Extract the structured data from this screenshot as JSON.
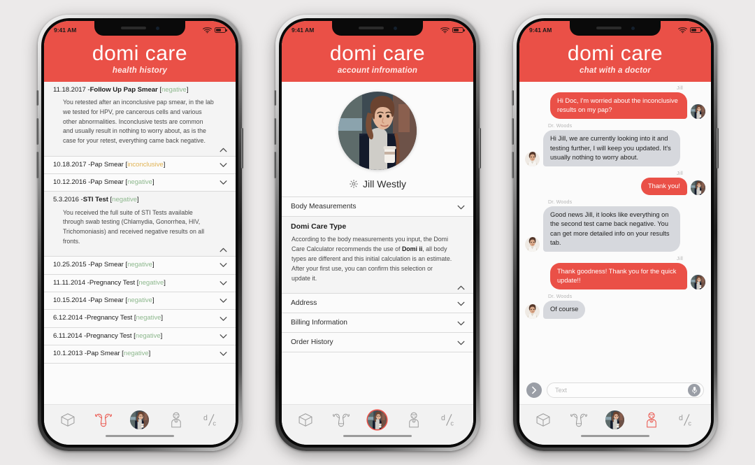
{
  "app": {
    "brand": "domi care",
    "accent": "#ea5047",
    "background": "#eceaea",
    "negative_color": "#8fb98f",
    "inconclusive_color": "#e0b354"
  },
  "status_bar": {
    "time": "9:41 AM",
    "wifi": "wifi-icon",
    "battery": "battery-icon"
  },
  "phone1": {
    "subtitle": "health history",
    "items": [
      {
        "date": "11.18.2017 - ",
        "title": "Follow Up Pap Smear",
        "bold": true,
        "result": "negative",
        "result_type": "negative",
        "open": true,
        "body": "You retested after an inconclusive pap smear, in the lab we tested for HPV, pre cancerous cells and various other abnormalities. Inconclusive tests are common and usually result in nothing to worry about, as is the case for your retest, everything came back negative."
      },
      {
        "date": "10.18.2017 - ",
        "title": "Pap Smear",
        "bold": false,
        "result": "inconclusive",
        "result_type": "inconclusive",
        "open": false,
        "body": ""
      },
      {
        "date": "10.12.2016 - ",
        "title": "Pap Smear",
        "bold": false,
        "result": "negative",
        "result_type": "negative",
        "open": false,
        "body": ""
      },
      {
        "date": "5.3.2016 - ",
        "title": "STI Test",
        "bold": true,
        "result": "negative",
        "result_type": "negative",
        "open": true,
        "body": "You received the full suite of STI Tests available through swab testing (Chlamydia, Gonorrhea, HIV, Trichomoniasis) and received negative results on all fronts."
      },
      {
        "date": "10.25.2015 - ",
        "title": "Pap Smear",
        "bold": false,
        "result": "negative",
        "result_type": "negative",
        "open": false,
        "body": ""
      },
      {
        "date": "11.11.2014 - ",
        "title": "Pregnancy Test",
        "bold": false,
        "result": "negative",
        "result_type": "negative",
        "open": false,
        "body": ""
      },
      {
        "date": "10.15.2014 - ",
        "title": "Pap Smear",
        "bold": false,
        "result": "negative",
        "result_type": "negative",
        "open": false,
        "body": ""
      },
      {
        "date": "6.12.2014 - ",
        "title": "Pregnancy Test",
        "bold": false,
        "result": "negative",
        "result_type": "negative",
        "open": false,
        "body": ""
      },
      {
        "date": "6.11.2014 - ",
        "title": "Pregnancy Test",
        "bold": false,
        "result": "negative",
        "result_type": "negative",
        "open": false,
        "body": ""
      },
      {
        "date": "10.1.2013 - ",
        "title": "Pap Smear",
        "bold": false,
        "result": "negative",
        "result_type": "negative",
        "open": false,
        "body": ""
      }
    ],
    "tabs": [
      {
        "icon": "package-box-icon",
        "active": false
      },
      {
        "icon": "uterus-icon",
        "active": true
      },
      {
        "icon": "profile-photo-icon",
        "active": false
      },
      {
        "icon": "doctor-icon",
        "active": false
      },
      {
        "icon": "domi-care-logo-icon",
        "active": false
      }
    ]
  },
  "phone2": {
    "subtitle": "account infromation",
    "user_name": "Jill Westly",
    "settings_icon": "gear-icon",
    "rows": [
      {
        "label": "Body Measurements",
        "open": false,
        "body_title": "",
        "body": ""
      },
      {
        "label": "",
        "open": true,
        "body_title": "Domi Care Type",
        "body_pre": "According to the body measurements you input, the Domi Care Calculator recommends the use of ",
        "body_bold": "Domi ii",
        "body_post": ", all body types are different and this initial calculation is an estimate. After your first use, you can confirm this selection or update it."
      },
      {
        "label": "Address",
        "open": false,
        "body_title": "",
        "body": ""
      },
      {
        "label": "Billing Information",
        "open": false,
        "body_title": "",
        "body": ""
      },
      {
        "label": "Order History",
        "open": false,
        "body_title": "",
        "body": ""
      }
    ],
    "tabs": [
      {
        "icon": "package-box-icon",
        "active": false
      },
      {
        "icon": "uterus-icon",
        "active": false
      },
      {
        "icon": "profile-photo-icon",
        "active": true
      },
      {
        "icon": "doctor-icon",
        "active": false
      },
      {
        "icon": "domi-care-logo-icon",
        "active": false
      }
    ]
  },
  "phone3": {
    "subtitle": "chat with a doctor",
    "messages": [
      {
        "sender": "Jill",
        "side": "me",
        "text": "Hi Doc, I'm worried about the inconclusive results on my pap?"
      },
      {
        "sender": "Dr. Woods",
        "side": "them",
        "text": "Hi Jill, we are currently looking into it and testing further, I will keep you updated. It's usually nothing to worry about."
      },
      {
        "sender": "Jill",
        "side": "me",
        "text": "Thank you!"
      },
      {
        "sender": "Dr. Woods",
        "side": "them",
        "text": "Good news Jill, it looks like everything on the second test came back negative. You can get more detailed info on your results tab."
      },
      {
        "sender": "Jill",
        "side": "me",
        "text": "Thank goodness! Thank you for the quick update!!"
      },
      {
        "sender": "Dr. Woods",
        "side": "them",
        "text": "Of course"
      }
    ],
    "input": {
      "value": "",
      "placeholder": "Text",
      "send_icon": "send-chevron-icon",
      "mic_icon": "microphone-icon"
    },
    "tabs": [
      {
        "icon": "package-box-icon",
        "active": false
      },
      {
        "icon": "uterus-icon",
        "active": false
      },
      {
        "icon": "profile-photo-icon",
        "active": false
      },
      {
        "icon": "doctor-icon",
        "active": true
      },
      {
        "icon": "domi-care-logo-icon",
        "active": false
      }
    ]
  }
}
